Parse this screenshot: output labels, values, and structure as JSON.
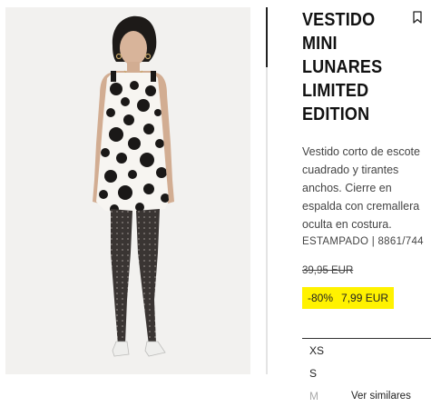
{
  "product": {
    "title_lines": [
      "VESTIDO",
      "MINI",
      "LUNARES",
      "LIMITED",
      "EDITION"
    ],
    "description_lines": [
      "Vestido corto de escote",
      "cuadrado y tirantes",
      "anchos. Cierre en",
      "espalda con cremallera",
      "oculta en costura."
    ],
    "reference": "ESTAMPADO | 8861/744",
    "original_price": "39,95 EUR",
    "discount": "-80%",
    "sale_price": "7,99 EUR",
    "sale_color": "#fff200"
  },
  "sizes": [
    {
      "label": "XS",
      "available": true
    },
    {
      "label": "S",
      "available": true
    },
    {
      "label": "M",
      "available": false,
      "action": "Ver similares"
    }
  ],
  "icons": {
    "bookmark": "bookmark-icon"
  }
}
